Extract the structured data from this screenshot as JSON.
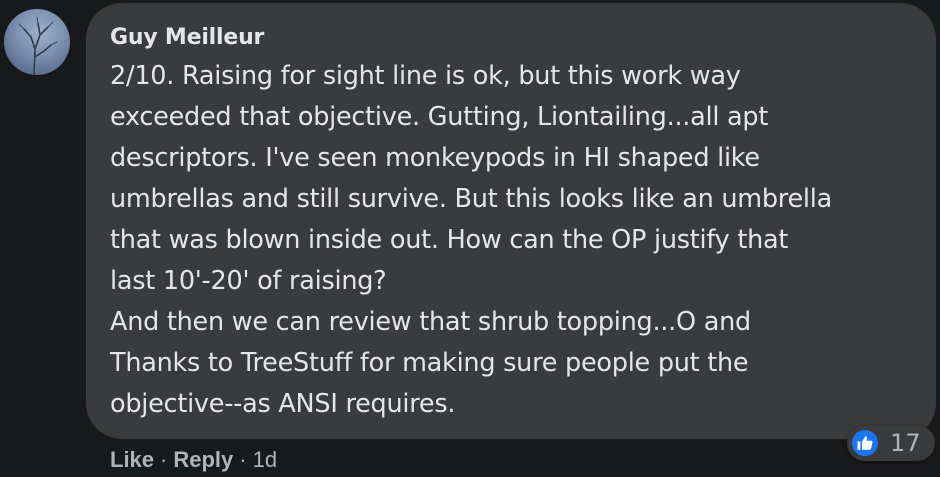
{
  "comment": {
    "author": "Guy Meilleur",
    "lines": [
      "2/10. Raising for sight line is ok, but this work way",
      "exceeded that objective. Gutting, Liontailing...all apt",
      "descriptors. I've seen monkeypods in HI shaped like",
      "umbrellas and still survive. But this looks like an umbrella",
      "that was blown inside out. How can the OP justify that",
      "last 10'-20' of raising?",
      "And then we can review that shrub topping...O and",
      "Thanks to TreeStuff for making sure people put the",
      "objective--as ANSI requires."
    ],
    "reaction_icon": "thumbs-up-icon",
    "reaction_count": "17"
  },
  "actions": {
    "like_label": "Like",
    "reply_label": "Reply",
    "separator": "·",
    "timestamp": "1d"
  },
  "colors": {
    "page_background": "#18191a",
    "bubble_background": "#3a3b3c",
    "primary_text": "#e4e6eb",
    "secondary_text": "#b0b3b8",
    "like_blue": "#1877f2"
  }
}
